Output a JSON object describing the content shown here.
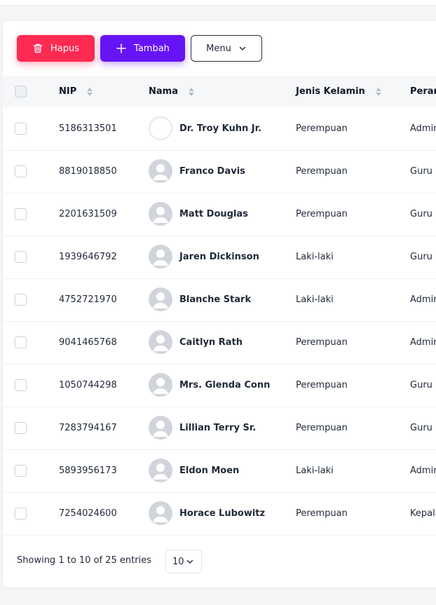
{
  "toolbar": {
    "delete_label": "Hapus",
    "add_label": "Tambah",
    "menu_label": "Menu"
  },
  "table": {
    "columns": [
      "NIP",
      "Nama",
      "Jenis Kelamin",
      "Peran"
    ],
    "rows": [
      {
        "nip": "5186313501",
        "nama": "Dr. Troy Kuhn Jr.",
        "jk": "Perempuan",
        "peran": "Admin",
        "avatar": "image-placeholder"
      },
      {
        "nip": "8819018850",
        "nama": "Franco Davis",
        "jk": "Perempuan",
        "peran": "Guru",
        "avatar": "default-user-avatar"
      },
      {
        "nip": "2201631509",
        "nama": "Matt Douglas",
        "jk": "Perempuan",
        "peran": "Guru",
        "avatar": "default-user-avatar"
      },
      {
        "nip": "1939646792",
        "nama": "Jaren Dickinson",
        "jk": "Laki-laki",
        "peran": "Guru",
        "avatar": "default-user-avatar"
      },
      {
        "nip": "4752721970",
        "nama": "Blanche Stark",
        "jk": "Laki-laki",
        "peran": "Admin",
        "avatar": "default-user-avatar"
      },
      {
        "nip": "9041465768",
        "nama": "Caitlyn Rath",
        "jk": "Perempuan",
        "peran": "Admin",
        "avatar": "default-user-avatar"
      },
      {
        "nip": "1050744298",
        "nama": "Mrs. Glenda Conn",
        "jk": "Perempuan",
        "peran": "Guru",
        "avatar": "default-user-avatar"
      },
      {
        "nip": "7283794167",
        "nama": "Lillian Terry Sr.",
        "jk": "Perempuan",
        "peran": "Guru",
        "avatar": "default-user-avatar"
      },
      {
        "nip": "5893956173",
        "nama": "Eldon Moen",
        "jk": "Laki-laki",
        "peran": "Admin",
        "avatar": "default-user-avatar"
      },
      {
        "nip": "7254024600",
        "nama": "Horace Lubowitz",
        "jk": "Perempuan",
        "peran": "Kepala",
        "avatar": "default-user-avatar"
      }
    ]
  },
  "footer": {
    "showing_text": "Showing 1 to 10 of 25 entries",
    "page_size": "10"
  },
  "colors": {
    "delete": "#ff2a52",
    "add": "#6613f6"
  }
}
